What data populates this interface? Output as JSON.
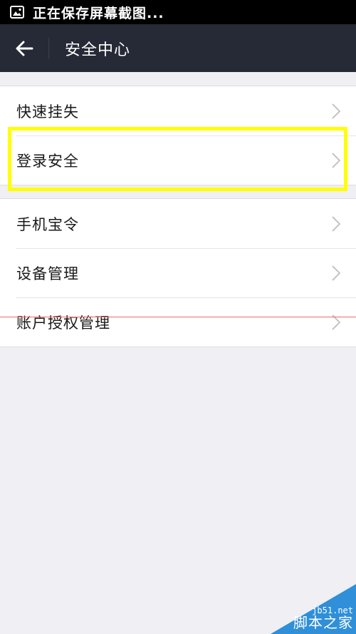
{
  "status_bar": {
    "text": "正在保存屏幕截图...",
    "icon": "image-icon"
  },
  "nav": {
    "title": "安全中心",
    "back_icon": "arrow-left-icon"
  },
  "groups": [
    {
      "items": [
        {
          "label": "快速挂失"
        },
        {
          "label": "登录安全"
        }
      ]
    },
    {
      "items": [
        {
          "label": "手机宝令"
        },
        {
          "label": "设备管理"
        },
        {
          "label": "账户授权管理"
        }
      ]
    }
  ],
  "annotation": {
    "highlight_color": "#ffff00",
    "line_color": "#f06a6a"
  },
  "watermark": {
    "domain": "jb51.net",
    "name": "脚本之家",
    "color": "#2f8fd8"
  },
  "colors": {
    "nav_background": "#262a36",
    "page_background": "#efeff4"
  }
}
